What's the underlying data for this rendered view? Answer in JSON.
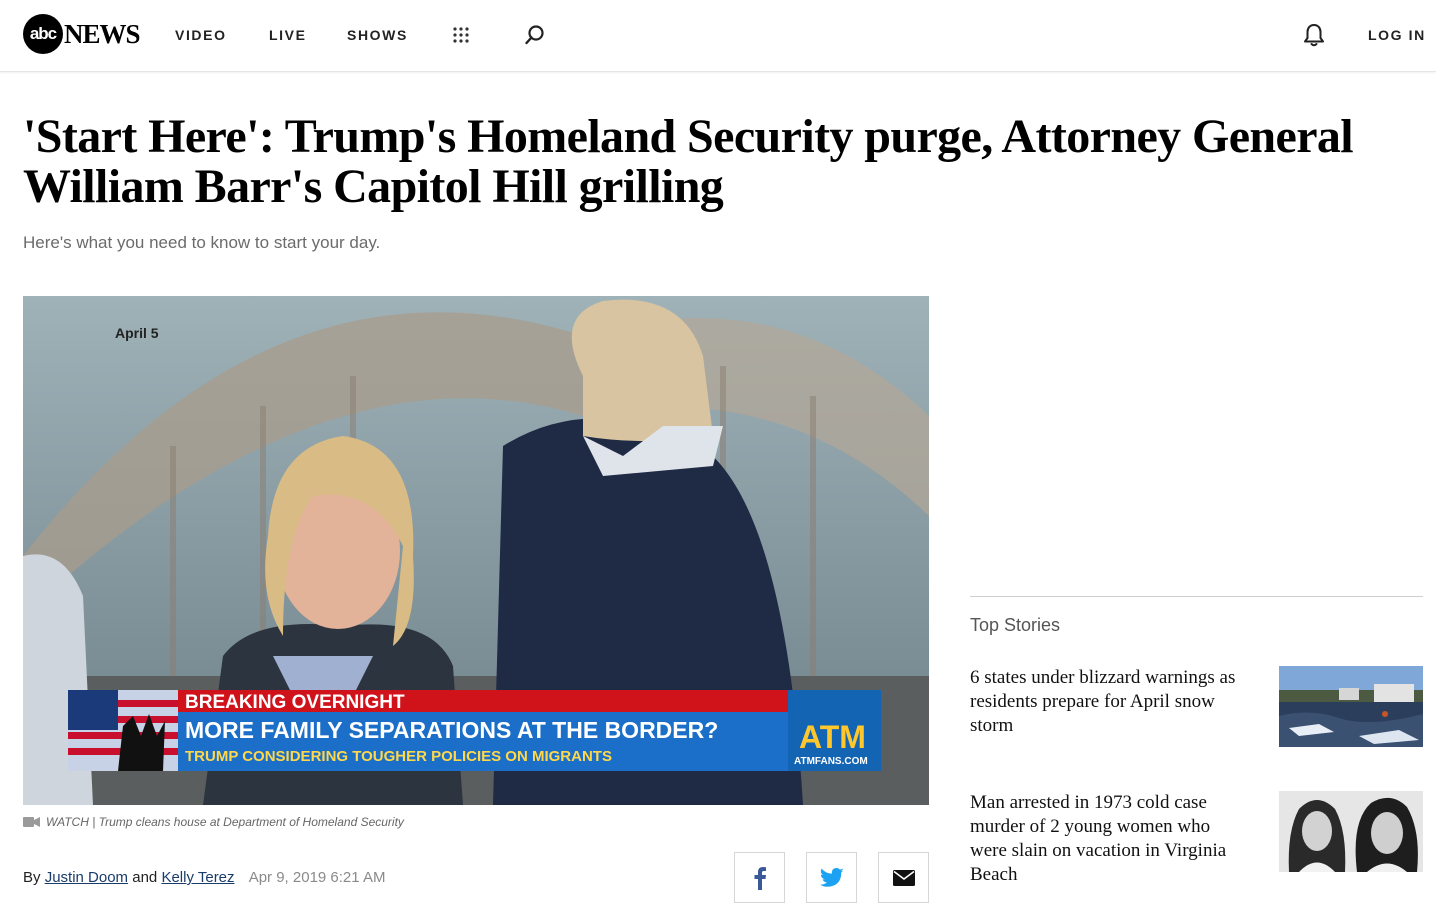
{
  "nav": {
    "logo_abc": "abc",
    "logo_news": "NEWS",
    "items": [
      "VIDEO",
      "LIVE",
      "SHOWS"
    ],
    "login_label": "LOG IN"
  },
  "article": {
    "headline": "'Start Here': Trump's Homeland Security purge, Attorney General William Barr's Capitol Hill grilling",
    "dek": "Here's what you need to know to start your day.",
    "hero": {
      "date_stamp": "April 5",
      "banner_top": "BREAKING OVERNIGHT",
      "banner_main": "MORE FAMILY SEPARATIONS AT THE BORDER?",
      "banner_sub": "TRUMP CONSIDERING TOUGHER POLICIES ON MIGRANTS",
      "brand": "ATM",
      "brand_url": "ATMFANS.COM"
    },
    "caption": "WATCH | Trump cleans house at Department of Homeland Security",
    "byline_prefix": "By",
    "author1": "Justin Doom",
    "byline_and": "and",
    "author2": "Kelly Terez",
    "date": "Apr 9, 2019 6:21 AM"
  },
  "sidebar": {
    "title": "Top Stories",
    "stories": [
      {
        "title": "6 states under blizzard warnings as residents prepare for April snow storm"
      },
      {
        "title": "Man arrested in 1973 cold case murder of 2 young women who were slain on vacation in Virginia Beach"
      }
    ]
  },
  "colors": {
    "banner_red": "#d0131b",
    "banner_blue": "#1b6fc8",
    "link_blue": "#1a3c6b",
    "facebook": "#3b5998",
    "twitter": "#1da1f2"
  }
}
